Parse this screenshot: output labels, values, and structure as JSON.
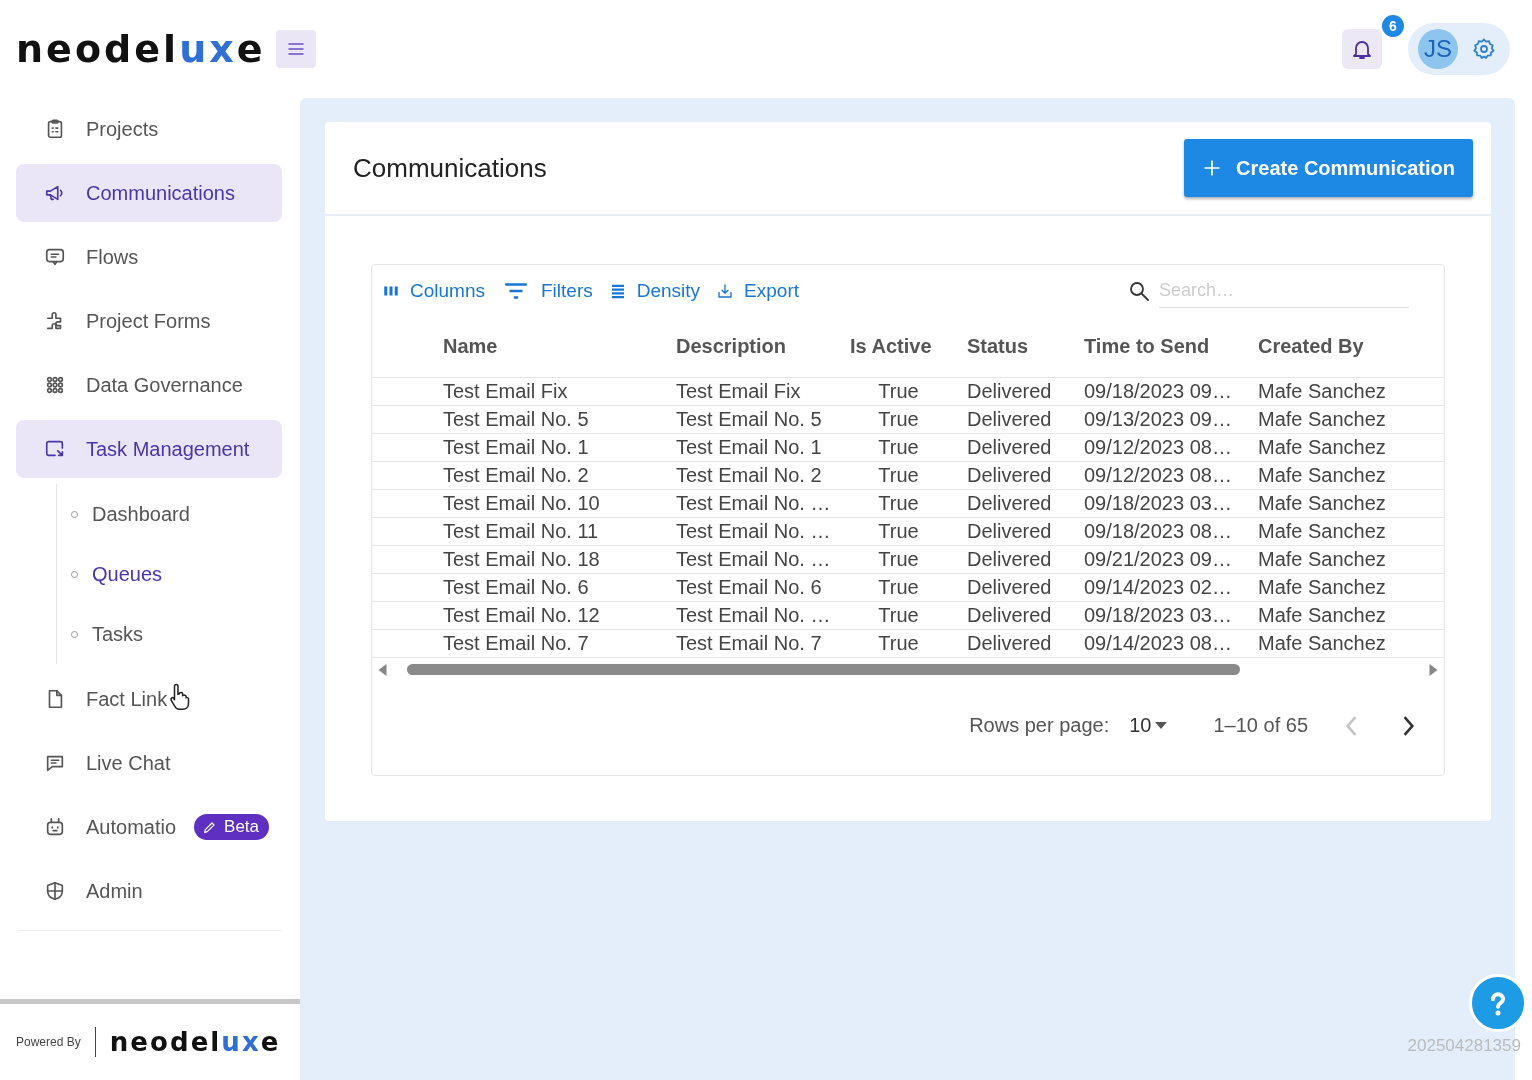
{
  "header": {
    "logo": {
      "start": "neodel",
      "accent": "ux",
      "end": "e"
    },
    "notifications": {
      "count": "6"
    },
    "avatar": {
      "initials": "JS"
    }
  },
  "sidebar": {
    "items": [
      {
        "label": "Projects",
        "selected": false
      },
      {
        "label": "Communications",
        "selected": true
      },
      {
        "label": "Flows",
        "selected": false
      },
      {
        "label": "Project Forms",
        "selected": false
      },
      {
        "label": "Data Governance",
        "selected": false
      },
      {
        "label": "Task Management",
        "selected": true,
        "expanded": true,
        "children": [
          {
            "label": "Dashboard",
            "selected": false
          },
          {
            "label": "Queues",
            "selected": true
          },
          {
            "label": "Tasks",
            "selected": false
          }
        ]
      },
      {
        "label": "Fact Link",
        "selected": false
      },
      {
        "label": "Live Chat",
        "selected": false
      },
      {
        "label": "Automatio",
        "selected": false,
        "badge": "Beta"
      },
      {
        "label": "Admin",
        "selected": false
      }
    ],
    "footer": {
      "powered_by": "Powered By",
      "logo": {
        "start": "neodel",
        "accent": "ux",
        "end": "e"
      }
    }
  },
  "page": {
    "title": "Communications",
    "create_button": "Create Communication",
    "toolbar": [
      {
        "label": "Columns"
      },
      {
        "label": "Filters"
      },
      {
        "label": "Density"
      },
      {
        "label": "Export"
      }
    ],
    "search": {
      "placeholder": "Search…"
    },
    "table": {
      "columns": [
        "Name",
        "Description",
        "Is Active",
        "Status",
        "Time to Send",
        "Created By"
      ],
      "rows": [
        [
          "Test Email Fix",
          "Test Email Fix",
          "True",
          "Delivered",
          "09/18/2023 09…",
          "Mafe Sanchez"
        ],
        [
          "Test Email No. 5",
          "Test Email No. 5",
          "True",
          "Delivered",
          "09/13/2023 09…",
          "Mafe Sanchez"
        ],
        [
          "Test Email No. 1",
          "Test Email No. 1",
          "True",
          "Delivered",
          "09/12/2023 08…",
          "Mafe Sanchez"
        ],
        [
          "Test Email No. 2",
          "Test Email No. 2",
          "True",
          "Delivered",
          "09/12/2023 08…",
          "Mafe Sanchez"
        ],
        [
          "Test Email No. 10",
          "Test Email No. …",
          "True",
          "Delivered",
          "09/18/2023 03…",
          "Mafe Sanchez"
        ],
        [
          "Test Email No. 11",
          "Test Email No. …",
          "True",
          "Delivered",
          "09/18/2023 08…",
          "Mafe Sanchez"
        ],
        [
          "Test Email No. 18",
          "Test Email No. …",
          "True",
          "Delivered",
          "09/21/2023 09…",
          "Mafe Sanchez"
        ],
        [
          "Test Email No. 6",
          "Test Email No. 6",
          "True",
          "Delivered",
          "09/14/2023 02…",
          "Mafe Sanchez"
        ],
        [
          "Test Email No. 12",
          "Test Email No. …",
          "True",
          "Delivered",
          "09/18/2023 03…",
          "Mafe Sanchez"
        ],
        [
          "Test Email No. 7",
          "Test Email No. 7",
          "True",
          "Delivered",
          "09/14/2023 08…",
          "Mafe Sanchez"
        ]
      ]
    },
    "pagination": {
      "rows_per_page_label": "Rows per page:",
      "rows_per_page": "10",
      "range": "1–10 of 65",
      "prev_disabled": true,
      "next_disabled": false
    }
  },
  "version": "202504281359"
}
